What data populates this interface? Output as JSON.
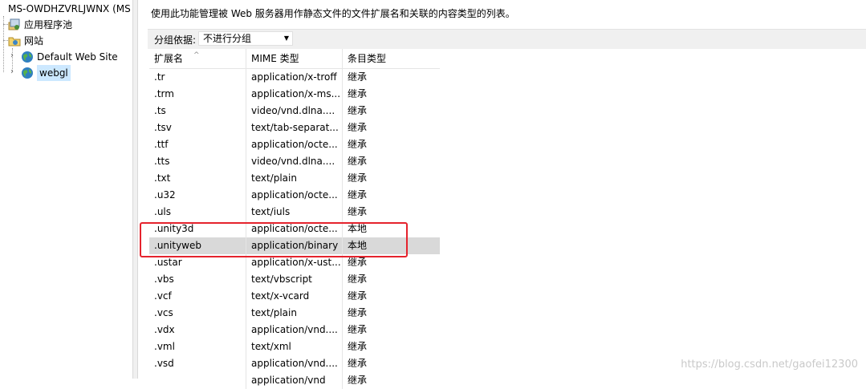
{
  "tree": {
    "root_label": "MS-OWDHZVRLJWNX (MS",
    "items": [
      {
        "label": "应用程序池",
        "icon": "app-pool-icon"
      },
      {
        "label": "网站",
        "icon": "sites-folder-icon"
      },
      {
        "label": "Default Web Site",
        "icon": "globe-icon"
      },
      {
        "label": "webgl",
        "icon": "globe-icon"
      }
    ]
  },
  "description": "使用此功能管理被 Web 服务器用作静态文件的文件扩展名和关联的内容类型的列表。",
  "group": {
    "label": "分组依据:",
    "value": "不进行分组"
  },
  "table": {
    "columns": [
      "扩展名",
      "MIME 类型",
      "条目类型"
    ],
    "rows": [
      [
        "",
        "",
        ""
      ],
      [
        ".tr",
        "application/x-troff",
        "继承"
      ],
      [
        ".trm",
        "application/x-ms...",
        "继承"
      ],
      [
        ".ts",
        "video/vnd.dlna....",
        "继承"
      ],
      [
        ".tsv",
        "text/tab-separat...",
        "继承"
      ],
      [
        ".ttf",
        "application/octe...",
        "继承"
      ],
      [
        ".tts",
        "video/vnd.dlna....",
        "继承"
      ],
      [
        ".txt",
        "text/plain",
        "继承"
      ],
      [
        ".u32",
        "application/octe...",
        "继承"
      ],
      [
        ".uls",
        "text/iuls",
        "继承"
      ],
      [
        ".unity3d",
        "application/octe...",
        "本地"
      ],
      [
        ".unityweb",
        "application/binary",
        "本地"
      ],
      [
        ".ustar",
        "application/x-ust...",
        "继承"
      ],
      [
        ".vbs",
        "text/vbscript",
        "继承"
      ],
      [
        ".vcf",
        "text/x-vcard",
        "继承"
      ],
      [
        ".vcs",
        "text/plain",
        "继承"
      ],
      [
        ".vdx",
        "application/vnd....",
        "继承"
      ],
      [
        ".vml",
        "text/xml",
        "继承"
      ],
      [
        ".vsd",
        "application/vnd....",
        "继承"
      ],
      [
        "",
        "application/vnd",
        "继承"
      ]
    ],
    "selected_row": 11
  },
  "watermark": "https://blog.csdn.net/gaofei12300",
  "colors": {
    "annotation": "#e5232d",
    "selected_row": "#d9d9d9",
    "tree_selected": "#cce8ff"
  }
}
